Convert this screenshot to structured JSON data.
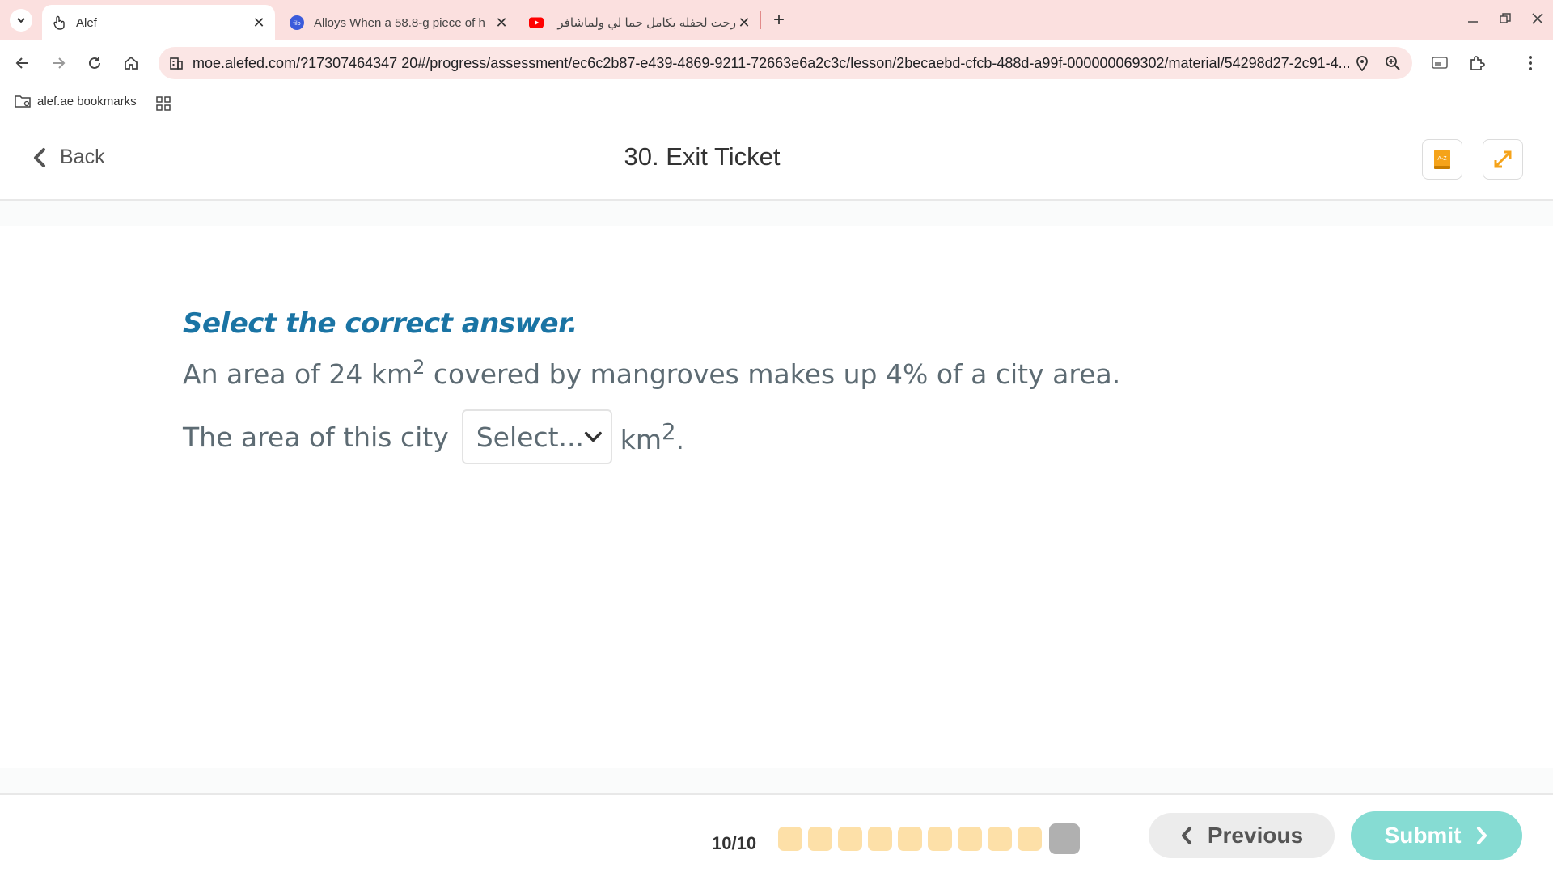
{
  "browser": {
    "tabs": [
      {
        "title": "Alef",
        "active": true,
        "icon": "hand-pointer-icon"
      },
      {
        "title": "Alloys When a 58.8-g piece of h",
        "active": false,
        "icon": "filo-icon"
      },
      {
        "title": "رحت لحفله بكامل جما لي ولماشافر",
        "active": false,
        "icon": "youtube-icon"
      }
    ],
    "url": "moe.alefed.com/?17307464347 20#/progress/assessment/ec6c2b87-e439-4869-9211-72663e6a2c3c/lesson/2becaebd-cfcb-488d-a99f-000000069302/material/54298d27-2c91-4...",
    "bookmark": "alef.ae bookmarks",
    "tab_close_glyph": "✕",
    "new_tab_glyph": "+",
    "filo_label": "filo"
  },
  "header": {
    "back_label": "Back",
    "title": "30. Exit Ticket",
    "glossary_icon_label": "A-Z"
  },
  "question": {
    "instruction": "Select the correct answer.",
    "line1_prefix": "An area of 24 km",
    "line1_sup": "2",
    "line1_suffix": " covered by mangroves makes up 4% of a city area.",
    "line2_prefix": "The area of this city",
    "select_placeholder": "Select...",
    "unit": "km",
    "unit_sup": "2",
    "unit_suffix": "."
  },
  "footer": {
    "progress": "10/10",
    "previous_label": "Previous",
    "submit_label": "Submit"
  },
  "colors": {
    "tabstrip": "#fbe0df",
    "instruction": "#1a74a4",
    "question_text": "#5d6b73",
    "dot_answered": "#fde0a8",
    "dot_current": "#b0b0b0",
    "submit": "#86dcd3",
    "accent_orange": "#f5a31a"
  }
}
